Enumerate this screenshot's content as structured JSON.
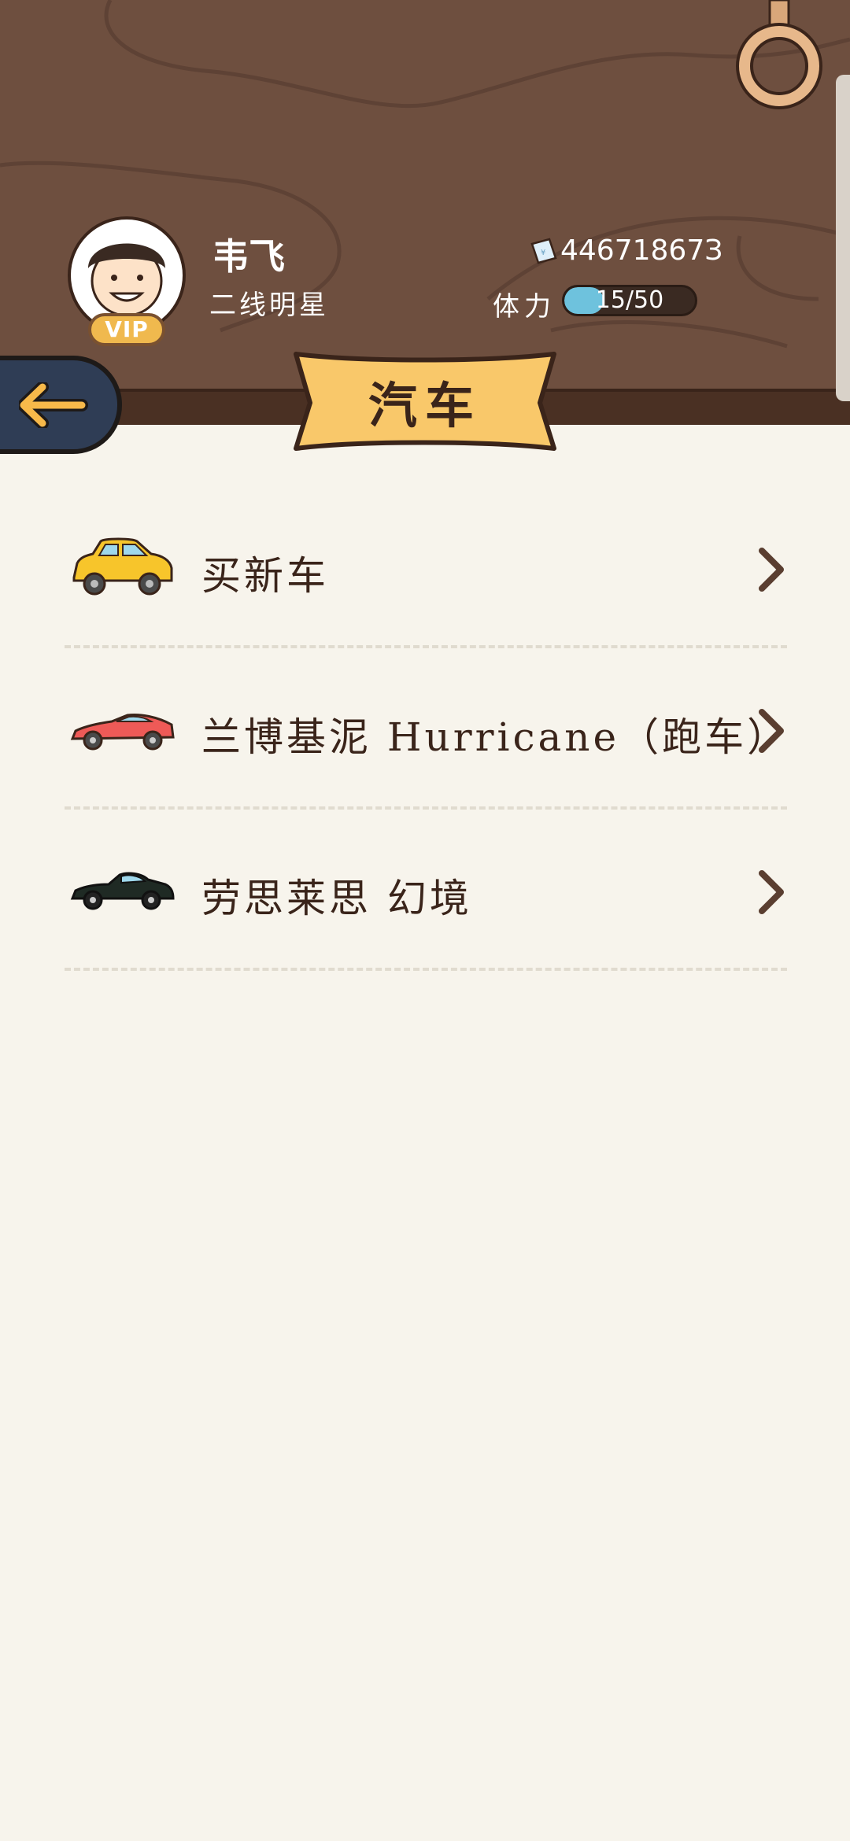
{
  "header": {
    "player_name": "韦飞",
    "player_title": "二线明星",
    "vip_label": "VIP",
    "money": "44671867З",
    "money_icon": "banknote-icon",
    "stamina_label": "体力",
    "stamina_text": "15/50",
    "stamina_fraction": 0.3
  },
  "page_title": "汽车",
  "back_icon": "back-arrow-icon",
  "list": [
    {
      "label": "买新车",
      "icon": "yellow-car-icon"
    },
    {
      "label": "兰博基泥 Hurricane（跑车）",
      "icon": "red-sportscar-icon"
    },
    {
      "label": "劳思莱思 幻境",
      "icon": "black-car-icon"
    }
  ],
  "colors": {
    "wood": "#6e4f3f",
    "banner": "#f9c86a",
    "background": "#f7f4ec",
    "text_dark": "#3a241a",
    "stamina_fill": "#6ec2dd"
  }
}
